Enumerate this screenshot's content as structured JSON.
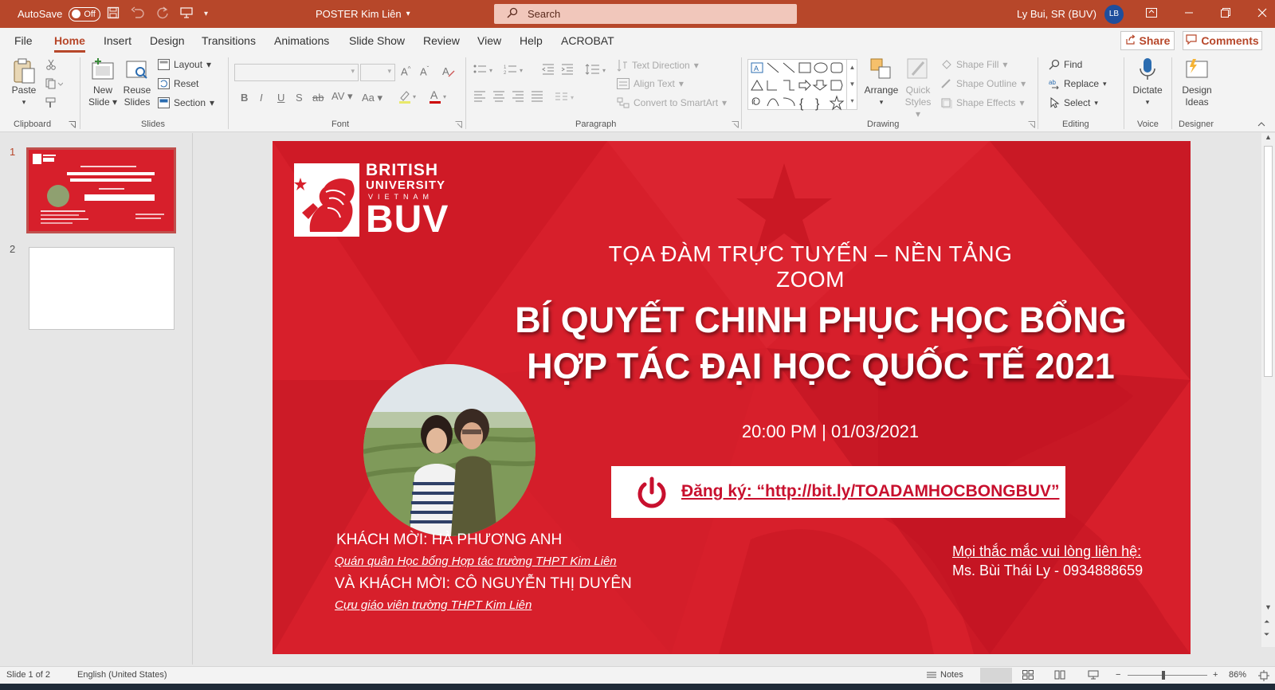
{
  "titlebar": {
    "autosave_label": "AutoSave",
    "autosave_state": "Off",
    "doc_title": "POSTER Kim Liên",
    "search_placeholder": "Search",
    "user_name": "Ly Bui, SR (BUV)",
    "user_initials": "LB"
  },
  "menu": {
    "tabs": [
      "File",
      "Home",
      "Insert",
      "Design",
      "Transitions",
      "Animations",
      "Slide Show",
      "Review",
      "View",
      "Help",
      "ACROBAT"
    ],
    "active_tab": "Home",
    "share": "Share",
    "comments": "Comments"
  },
  "ribbon": {
    "clipboard": {
      "paste": "Paste",
      "label": "Clipboard"
    },
    "slides": {
      "new_slide": "New Slide",
      "reuse_slides": "Reuse Slides",
      "layout": "Layout",
      "reset": "Reset",
      "section": "Section",
      "label": "Slides"
    },
    "font": {
      "label": "Font",
      "bold": "B",
      "italic": "I",
      "underline": "U",
      "strike": "S",
      "strike2": "ab",
      "spacing": "AV",
      "case": "Aa"
    },
    "paragraph": {
      "text_direction": "Text Direction",
      "align_text": "Align Text",
      "convert_smartart": "Convert to SmartArt",
      "label": "Paragraph"
    },
    "drawing": {
      "arrange": "Arrange",
      "quick_styles": "Quick Styles",
      "shape_fill": "Shape Fill",
      "shape_outline": "Shape Outline",
      "shape_effects": "Shape Effects",
      "label": "Drawing"
    },
    "editing": {
      "find": "Find",
      "replace": "Replace",
      "select": "Select",
      "label": "Editing"
    },
    "voice": {
      "dictate": "Dictate",
      "label": "Voice"
    },
    "designer": {
      "design_ideas": "Design Ideas",
      "label": "Designer"
    }
  },
  "slides_panel": {
    "slide_numbers": [
      "1",
      "2"
    ],
    "active": 1
  },
  "slide": {
    "logo_line1": "BRITISH",
    "logo_line2": "UNIVERSITY",
    "logo_line3": "VIETNAM",
    "logo_line4": "BUV",
    "subtitle": "TỌA ĐÀM TRỰC TUYẾN – NỀN TẢNG ZOOM",
    "headline_line1": "BÍ QUYẾT CHINH PHỤC HỌC BỔNG",
    "headline_line2": "HỢP TÁC ĐẠI HỌC QUỐC TẾ 2021",
    "datetime": "20:00 PM  |  01/03/2021",
    "register": "Đăng ký: “http://bit.ly/TOADAMHOCBONGBUV”",
    "guest1_name": "KHÁCH MỜI: HÀ PHƯƠNG ANH",
    "guest1_desc": "Quán quân Học bổng Hợp tác trường THPT Kim Liên",
    "guest2_name": "VÀ KHÁCH MỜI: CÔ NGUYỄN THỊ DUYÊN",
    "guest2_desc": "Cựu giáo viên trường THPT Kim Liên",
    "contact_line1": "Mọi thắc mắc vui lòng liên hệ:",
    "contact_line2": "Ms. Bùi Thái Ly - 0934888659"
  },
  "status": {
    "slide_count": "Slide 1 of 2",
    "language": "English (United States)",
    "notes": "Notes",
    "zoom": "86%"
  },
  "colors": {
    "accent": "#b7472a",
    "slide_red": "#d71f2b"
  }
}
